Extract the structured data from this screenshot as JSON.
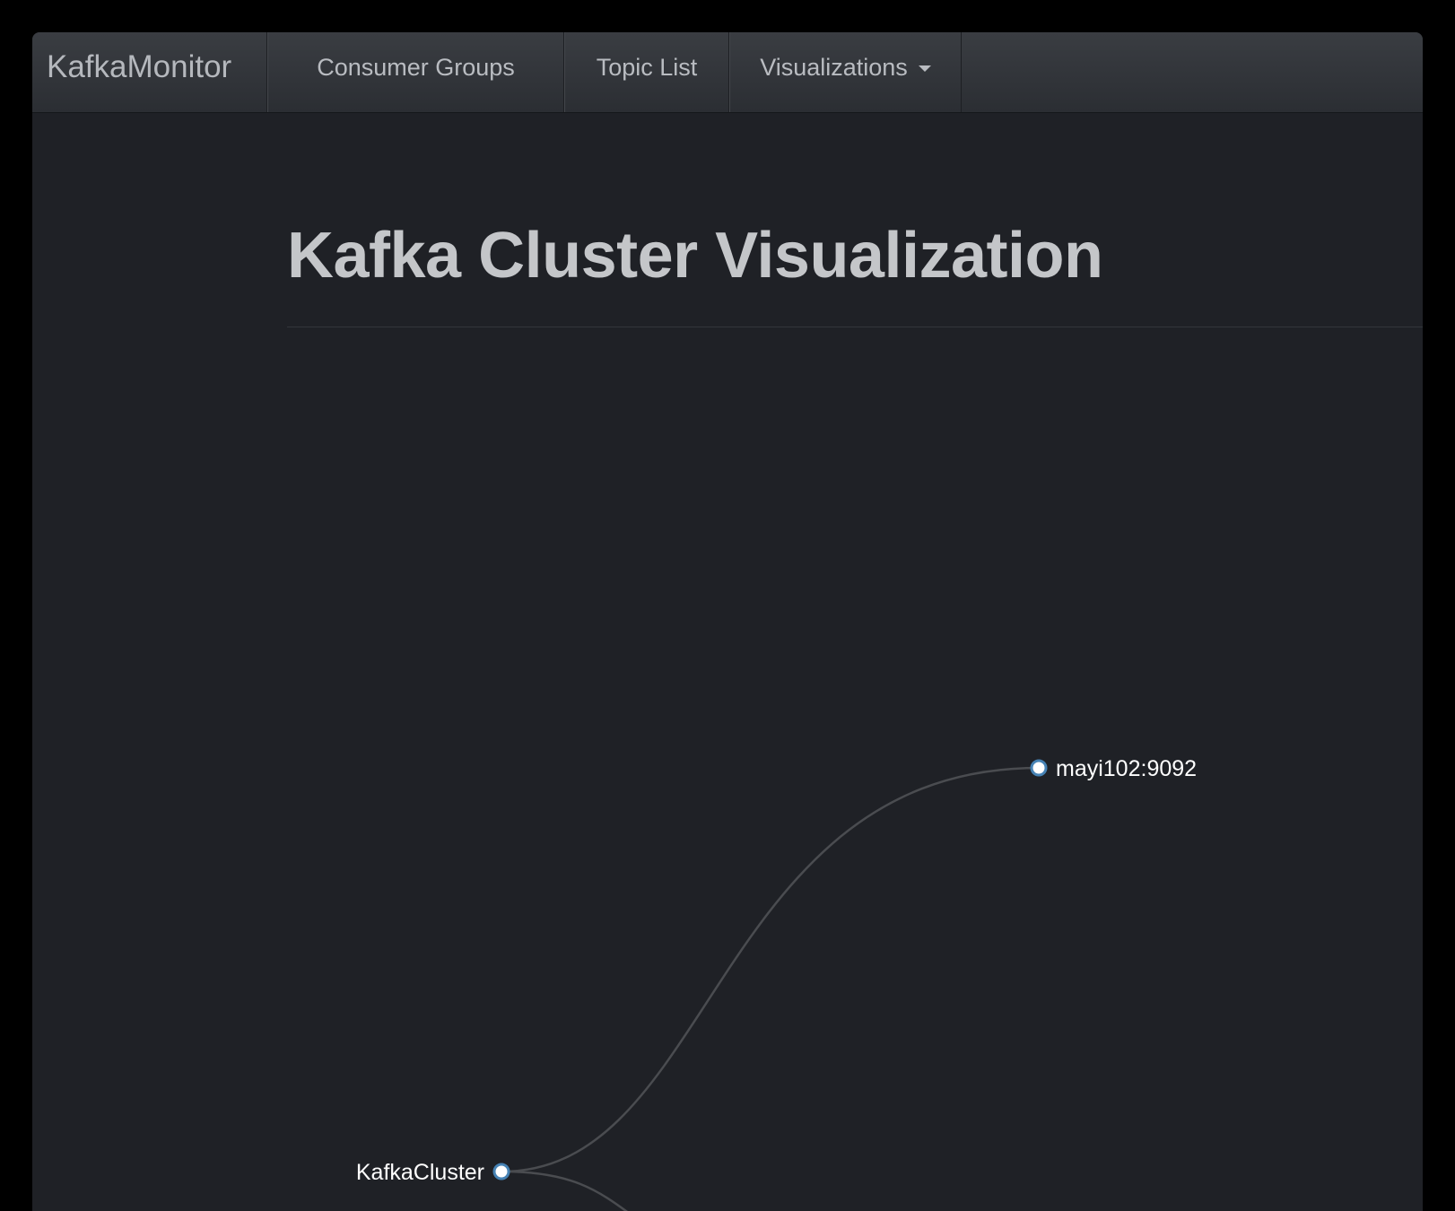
{
  "navbar": {
    "brand": "KafkaMonitor",
    "items": [
      {
        "label": "Consumer Groups"
      },
      {
        "label": "Topic List"
      },
      {
        "label": "Visualizations",
        "dropdown": true
      }
    ]
  },
  "page": {
    "title": "Kafka Cluster Visualization"
  },
  "tree": {
    "root": {
      "label": "KafkaCluster"
    },
    "children": [
      {
        "label": "mayi102:9092"
      }
    ]
  },
  "colors": {
    "background": "#1f2126",
    "navbar": "#2f3237",
    "link": "#4a4c50",
    "node_stroke": "#4682b4",
    "node_fill": "#ffffff",
    "label": "#ffffff"
  }
}
